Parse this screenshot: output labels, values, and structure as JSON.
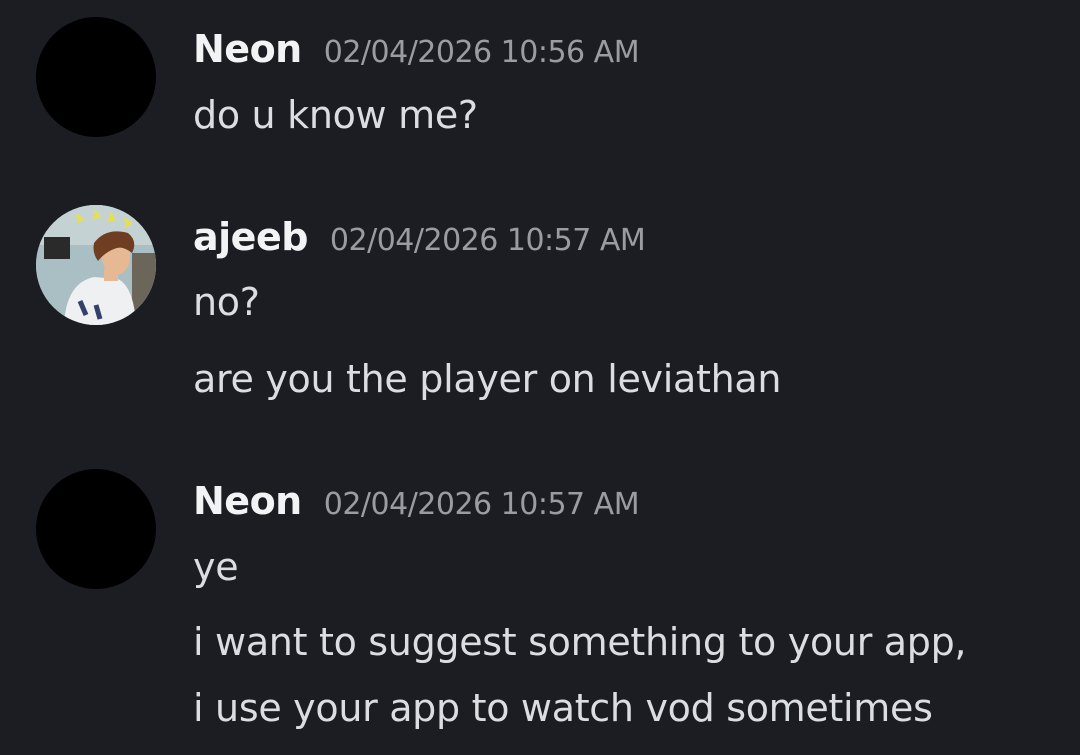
{
  "messages": [
    {
      "author": "Neon",
      "avatar": "blank-black-avatar",
      "timestamp": "02/04/2026 10:56 AM",
      "lines": [
        "do u know me?"
      ]
    },
    {
      "author": "ajeeb",
      "avatar": "comic-character-avatar",
      "timestamp": "02/04/2026 10:57 AM",
      "lines": [
        "no?",
        "are you the player on leviathan"
      ]
    },
    {
      "author": "Neon",
      "avatar": "blank-black-avatar",
      "timestamp": "02/04/2026 10:57 AM",
      "lines": [
        "ye",
        "i want to suggest something to your app,",
        "i use your app to watch vod sometimes"
      ]
    }
  ],
  "colors": {
    "background": "#1c1d22",
    "username": "#f2f3f5",
    "timestamp": "#9a9ca3",
    "message_text": "#dbdee1"
  }
}
